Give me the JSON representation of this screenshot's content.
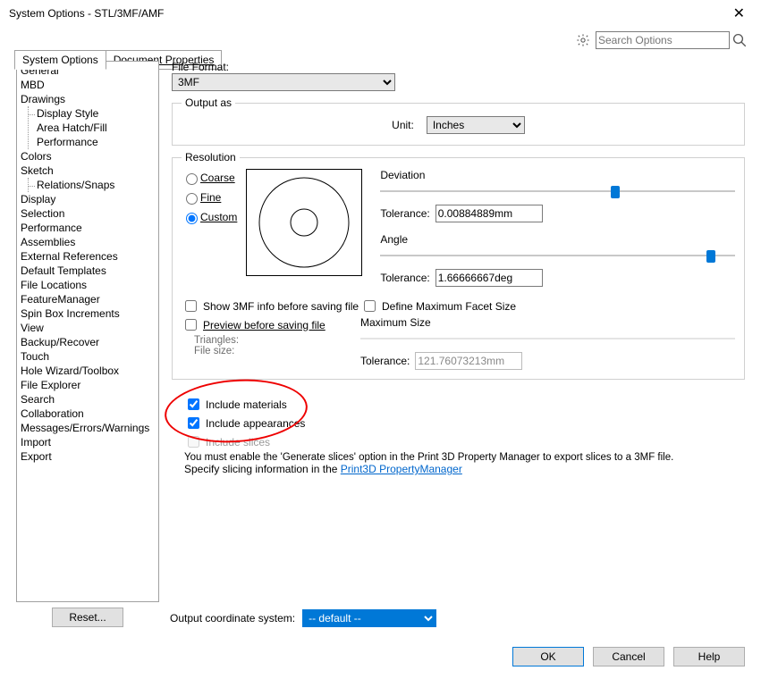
{
  "window": {
    "title": "System Options - STL/3MF/AMF"
  },
  "search": {
    "placeholder": "Search Options"
  },
  "tabs": {
    "system_options": "System Options",
    "document_properties": "Document Properties"
  },
  "nav": {
    "items": [
      "General",
      "MBD",
      "Drawings"
    ],
    "drawings_sub": [
      "Display Style",
      "Area Hatch/Fill",
      "Performance"
    ],
    "items2": [
      "Colors",
      "Sketch"
    ],
    "sketch_sub": [
      "Relations/Snaps"
    ],
    "items3": [
      "Display",
      "Selection",
      "Performance",
      "Assemblies",
      "External References",
      "Default Templates",
      "File Locations",
      "FeatureManager",
      "Spin Box Increments",
      "View",
      "Backup/Recover",
      "Touch",
      "Hole Wizard/Toolbox",
      "File Explorer",
      "Search",
      "Collaboration",
      "Messages/Errors/Warnings",
      "Import",
      "Export"
    ],
    "reset": "Reset..."
  },
  "main": {
    "file_format_label": "File Format:",
    "file_format_value": "3MF",
    "output_as": "Output as",
    "unit_label": "Unit:",
    "unit_value": "Inches",
    "resolution": "Resolution",
    "res_coarse": "Coarse",
    "res_fine": "Fine",
    "res_custom": "Custom",
    "deviation": "Deviation",
    "angle": "Angle",
    "tolerance": "Tolerance:",
    "dev_value": "0.00884889mm",
    "angle_value": "1.66666667deg",
    "show_info": "Show 3MF info before saving file",
    "preview": "Preview before saving file",
    "triangles": "Triangles:",
    "filesize": "File size:",
    "define_max": "Define Maximum Facet Size",
    "max_size": "Maximum Size",
    "max_value": "121.76073213mm",
    "include_materials": "Include materials",
    "include_appearances": "Include appearances",
    "include_slices": "Include slices",
    "slices_note1": "You must enable the 'Generate slices' option in the Print 3D Property Manager to export slices to a 3MF file.",
    "slices_note2a": "Specify slicing information in the ",
    "slices_note2_link": "Print3D PropertyManager",
    "coord_label": "Output coordinate system:",
    "coord_value": "-- default --"
  },
  "footer": {
    "ok": "OK",
    "cancel": "Cancel",
    "help": "Help"
  }
}
